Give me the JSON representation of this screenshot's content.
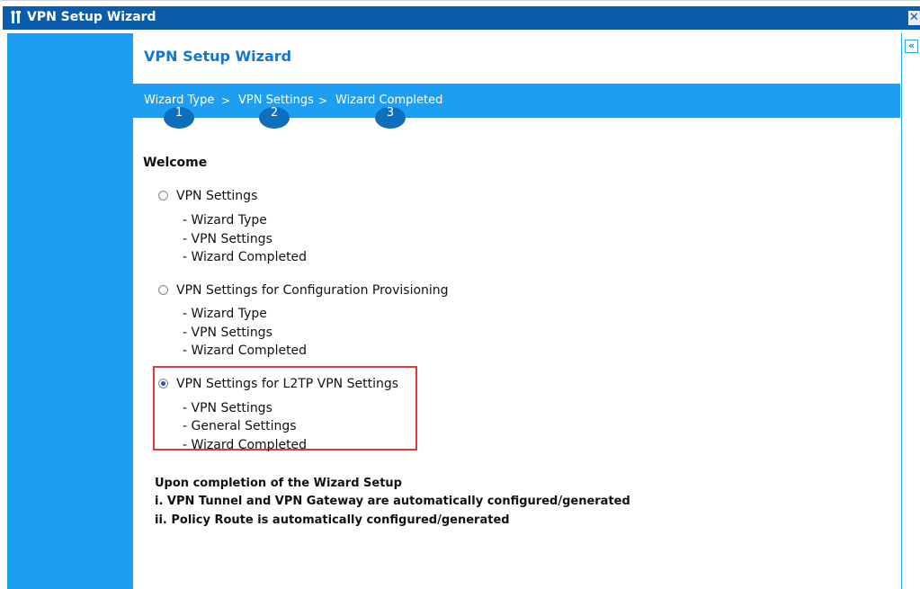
{
  "window": {
    "title": "VPN Setup Wizard"
  },
  "main": {
    "page_title": "VPN Setup Wizard",
    "steps": [
      {
        "label": "Wizard Type",
        "number": "1"
      },
      {
        "label": "VPN Settings",
        "number": "2"
      },
      {
        "label": "Wizard Completed",
        "number": "3"
      }
    ],
    "step_separator": ">",
    "welcome": "Welcome",
    "options": [
      {
        "label": "VPN Settings",
        "selected": false,
        "items": [
          "- Wizard Type",
          "- VPN Settings",
          "- Wizard Completed"
        ]
      },
      {
        "label": "VPN Settings for Configuration Provisioning",
        "selected": false,
        "items": [
          "- Wizard Type",
          "- VPN Settings",
          "- Wizard Completed"
        ]
      },
      {
        "label": "VPN Settings for L2TP VPN Settings",
        "selected": true,
        "items": [
          "- VPN Settings",
          "- General Settings",
          "- Wizard Completed"
        ]
      }
    ],
    "notes": [
      "Upon completion of the Wizard Setup",
      "i. VPN Tunnel and VPN Gateway are automatically configured/generated",
      "ii. Policy Route is automatically configured/generated"
    ]
  },
  "icons": {
    "title_icon": "wizard-tools-icon",
    "close_icon": "close-icon",
    "collapse_icon": "double-chevron-left-icon"
  },
  "colors": {
    "title_bar": "#0b5cab",
    "side_panel": "#1e9ef0",
    "steps_bar": "#1e9ef0",
    "step_circle": "#0e6fbe",
    "page_title": "#1577cc",
    "highlight_border": "#e0383c"
  }
}
